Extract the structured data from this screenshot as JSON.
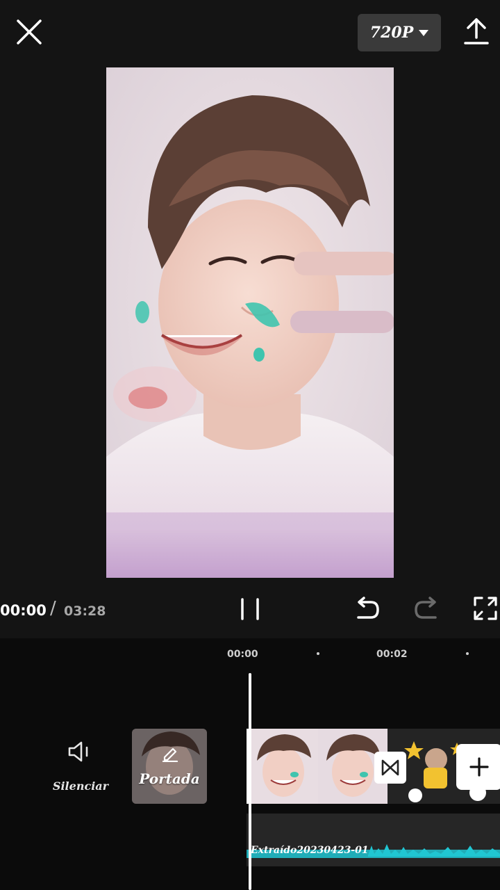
{
  "header": {
    "resolution_label": "720P",
    "close_icon": "close-icon",
    "export_icon": "upload-icon",
    "dropdown_icon": "caret-down-icon"
  },
  "player": {
    "current_time": "00:00",
    "separator": "/",
    "total_time": "03:28",
    "play_state": "playing"
  },
  "timeline": {
    "ruler_marks": [
      "00:00",
      "00:02"
    ],
    "mute": {
      "label": "Silenciar",
      "icon": "speaker-icon"
    },
    "cover": {
      "label": "Portada",
      "icon": "pencil-icon"
    },
    "audio_clip": {
      "name": "Extraído20230423-01"
    },
    "add_icon": "plus-icon",
    "transition_icon": "transition-icon"
  },
  "colors": {
    "background": "#141414",
    "timeline_background": "#0b0b0b",
    "audio_waveform": "#20c6d2",
    "playhead": "#ffffff"
  }
}
